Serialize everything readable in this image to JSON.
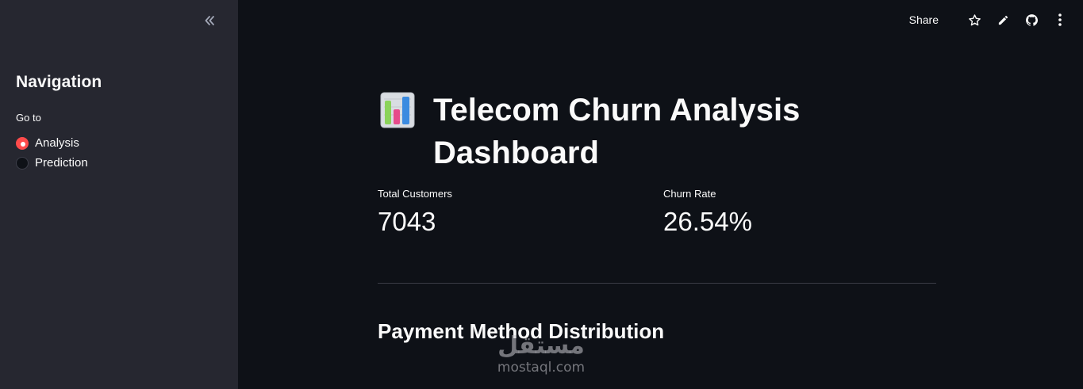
{
  "sidebar": {
    "collapse_icon": "double-chevron-left-icon",
    "title": "Navigation",
    "radio_label": "Go to",
    "options": [
      {
        "label": "Analysis",
        "selected": true
      },
      {
        "label": "Prediction",
        "selected": false
      }
    ],
    "accent_color": "#ff4b4b"
  },
  "toolbar": {
    "share_label": "Share",
    "icons": [
      "star-icon",
      "pencil-icon",
      "github-icon",
      "more-vertical-icon"
    ]
  },
  "main": {
    "title_icon": "bar-chart-icon",
    "title": "Telecom Churn Analysis Dashboard",
    "metrics": [
      {
        "label": "Total Customers",
        "value": "7043"
      },
      {
        "label": "Churn Rate",
        "value": "26.54%"
      }
    ],
    "section_title": "Payment Method Distribution"
  },
  "watermark": {
    "arabic": "مستقل",
    "latin": "mostaql.com"
  },
  "colors": {
    "background": "#0e1117",
    "sidebar_background": "#262730",
    "text": "#fafafa"
  }
}
